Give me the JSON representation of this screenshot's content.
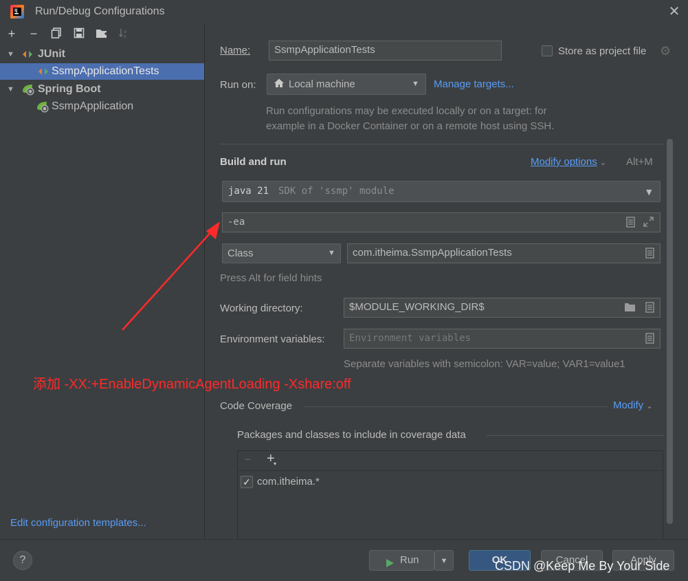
{
  "window": {
    "title": "Run/Debug Configurations"
  },
  "toolbar": {
    "icons": [
      "add-icon",
      "remove-icon",
      "copy-icon",
      "save-icon",
      "folder-add-icon",
      "sort-icon"
    ]
  },
  "tree": [
    {
      "label": "JUnit",
      "level": 0,
      "expanded": true,
      "icon": "junit-icon"
    },
    {
      "label": "SsmpApplicationTests",
      "level": 1,
      "selected": true,
      "icon": "junit-test-icon"
    },
    {
      "label": "Spring Boot",
      "level": 0,
      "expanded": true,
      "icon": "spring-boot-icon"
    },
    {
      "label": "SsmpApplication",
      "level": 1,
      "icon": "spring-boot-app-icon"
    }
  ],
  "left_footer": {
    "edit_templates": "Edit configuration templates..."
  },
  "form": {
    "name_label": "Name:",
    "name_value": "SsmpApplicationTests",
    "store_label": "Store as project file",
    "run_on_label": "Run on:",
    "run_on_value": "Local machine",
    "manage_targets": "Manage targets...",
    "run_on_hint_1": "Run configurations may be executed locally or on a target: for",
    "run_on_hint_2": "example in a Docker Container or on a remote host using SSH.",
    "build_run_title": "Build and run",
    "modify_options": "Modify options",
    "modify_shortcut": "Alt+M",
    "sdk_main": "java 21",
    "sdk_detail": "SDK of 'ssmp' module",
    "vm_options": "-ea",
    "test_kind": "Class",
    "class_value": "com.itheima.SsmpApplicationTests",
    "field_hint": "Press Alt for field hints",
    "workdir_label": "Working directory:",
    "workdir_value": "$MODULE_WORKING_DIR$",
    "env_label": "Environment variables:",
    "env_placeholder": "Environment variables",
    "env_hint": "Separate variables with semicolon: VAR=value; VAR1=value1",
    "coverage_title": "Code Coverage",
    "coverage_modify": "Modify",
    "coverage_packages_title": "Packages and classes to include in coverage data",
    "coverage_item": "com.itheima.*",
    "coverage_item_checked": true
  },
  "annotation": "添加 -XX:+EnableDynamicAgentLoading -Xshare:off",
  "buttons": {
    "run": "Run",
    "ok": "OK",
    "cancel": "Cancel",
    "apply": "Apply"
  },
  "watermark": "CSDN @Keep Me By Your Side",
  "colors": {
    "background": "#3c3f41",
    "field": "#45494a",
    "selection": "#4b6eaf",
    "link": "#589df6",
    "annotation": "#ff2a2a",
    "ok_button": "#365880"
  }
}
